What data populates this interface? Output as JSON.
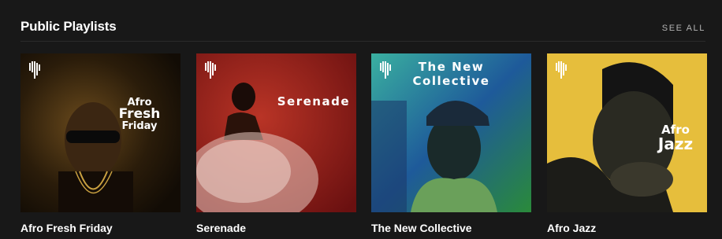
{
  "section": {
    "title": "Public Playlists",
    "see_all": "SEE ALL"
  },
  "playlists": [
    {
      "title": "Afro Fresh Friday",
      "cover_lines": [
        "Afro",
        "Fresh",
        "Friday"
      ],
      "bg": "#3a2a12"
    },
    {
      "title": "Serenade",
      "cover_lines": [
        "Serenade"
      ],
      "bg": "#a32a22"
    },
    {
      "title": "The New Collective",
      "cover_lines": [
        "The New",
        "Collective"
      ],
      "bg": "#2a7a7a"
    },
    {
      "title": "Afro Jazz",
      "cover_lines": [
        "Afro",
        "Jazz"
      ],
      "bg": "#e6be3c"
    }
  ],
  "icons": {
    "playlist_logo": "africa-logo-icon"
  }
}
